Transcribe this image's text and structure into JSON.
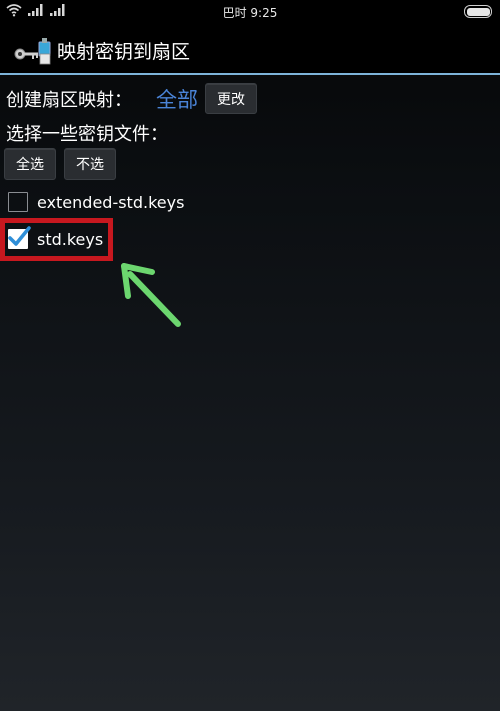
{
  "status_bar": {
    "time": "巴时 9:25"
  },
  "title_bar": {
    "title": "映射密钥到扇区",
    "icon": "keys-icon"
  },
  "sector_mapping": {
    "label": "创建扇区映射：",
    "value": "全部",
    "change_button": "更改"
  },
  "key_files": {
    "prompt": "选择一些密钥文件：",
    "select_all_button": "全选",
    "select_none_button": "不选",
    "items": [
      {
        "label": "extended-std.keys",
        "checked": false
      },
      {
        "label": "std.keys",
        "checked": true
      }
    ]
  },
  "colors": {
    "accent_blue": "#4a84d8",
    "divider": "#7db4d9",
    "highlight_red": "#c7181f",
    "arrow_green": "#6cd66f"
  }
}
